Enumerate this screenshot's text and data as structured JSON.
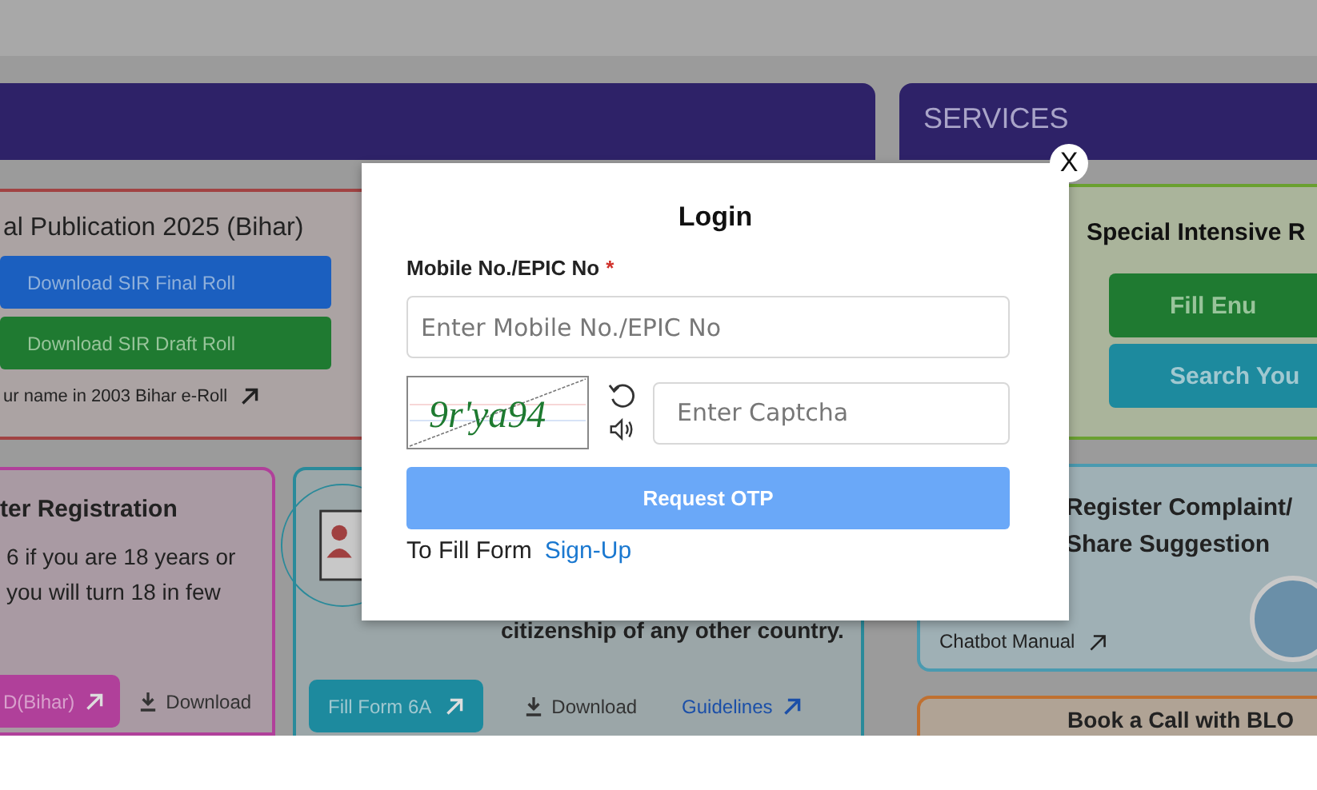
{
  "left_panel": {
    "publication_card": {
      "title": "al Publication 2025 (Bihar)",
      "buttons": [
        {
          "label": "Download SIR Final Roll",
          "kind": "primary"
        },
        {
          "label": "Download SIR Draft Roll",
          "kind": "success"
        }
      ],
      "link": "ur name in 2003 Bihar e-Roll"
    },
    "registration_card": {
      "title": "ter Registration",
      "lines": [
        "6 if you are 18 years or",
        "you will turn 18 in few"
      ],
      "button": "D(Bihar)",
      "download": "Download"
    },
    "overseas_card": {
      "text": "citizenship of any other country.",
      "button": "Fill Form 6A",
      "download": "Download",
      "guidelines": "Guidelines"
    }
  },
  "services": {
    "title": "SERVICES",
    "sir_card": {
      "title": "Special Intensive R",
      "buttons": [
        {
          "label": "Fill Enu",
          "kind": "success"
        },
        {
          "label": "Search You",
          "kind": "info"
        }
      ]
    },
    "complaint_card": {
      "title": "Register Complaint/",
      "subtitle": "Share Suggestion",
      "link": "Chatbot Manual"
    },
    "blo_card": {
      "title": "Book a Call with BLO"
    }
  },
  "login_dialog": {
    "title": "Login",
    "field_label": "Mobile No./EPIC No",
    "required_mark": "*",
    "mobile_field": {
      "placeholder": "Enter Mobile No./EPIC No"
    },
    "captcha_text": "9r'ya94",
    "captcha_field": {
      "placeholder": "Enter Captcha"
    },
    "submit": "Request OTP",
    "footer_text": "To Fill Form",
    "footer_link": "Sign-Up",
    "close": "X"
  }
}
